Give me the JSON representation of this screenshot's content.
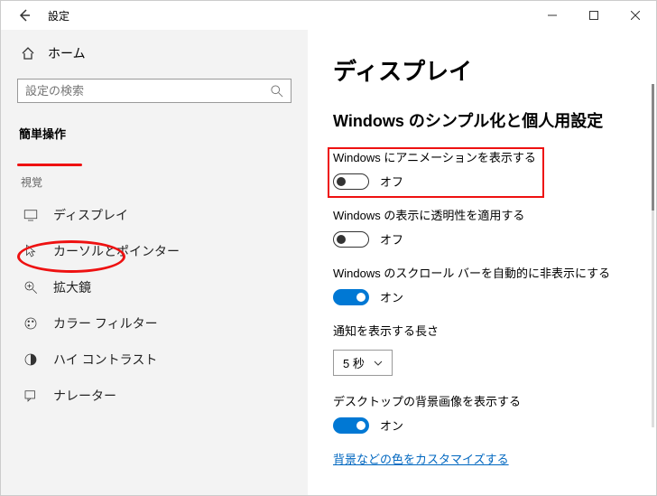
{
  "titlebar": {
    "title": "設定"
  },
  "sidebar": {
    "home": "ホーム",
    "search_placeholder": "設定の検索",
    "category": "簡単操作",
    "section_visual": "視覚",
    "items": [
      {
        "label": "ディスプレイ"
      },
      {
        "label": "カーソルとポインター"
      },
      {
        "label": "拡大鏡"
      },
      {
        "label": "カラー フィルター"
      },
      {
        "label": "ハイ コントラスト"
      },
      {
        "label": "ナレーター"
      }
    ]
  },
  "content": {
    "heading": "ディスプレイ",
    "subheading": "Windows のシンプル化と個人用設定",
    "settings": {
      "anim_label": "Windows にアニメーションを表示する",
      "anim_state": "オフ",
      "trans_label": "Windows の表示に透明性を適用する",
      "trans_state": "オフ",
      "scroll_label": "Windows のスクロール バーを自動的に非表示にする",
      "scroll_state": "オン",
      "notif_label": "通知を表示する長さ",
      "notif_value": "5 秒",
      "bg_label": "デスクトップの背景画像を表示する",
      "bg_state": "オン",
      "link": "背景などの色をカスタマイズする"
    }
  }
}
